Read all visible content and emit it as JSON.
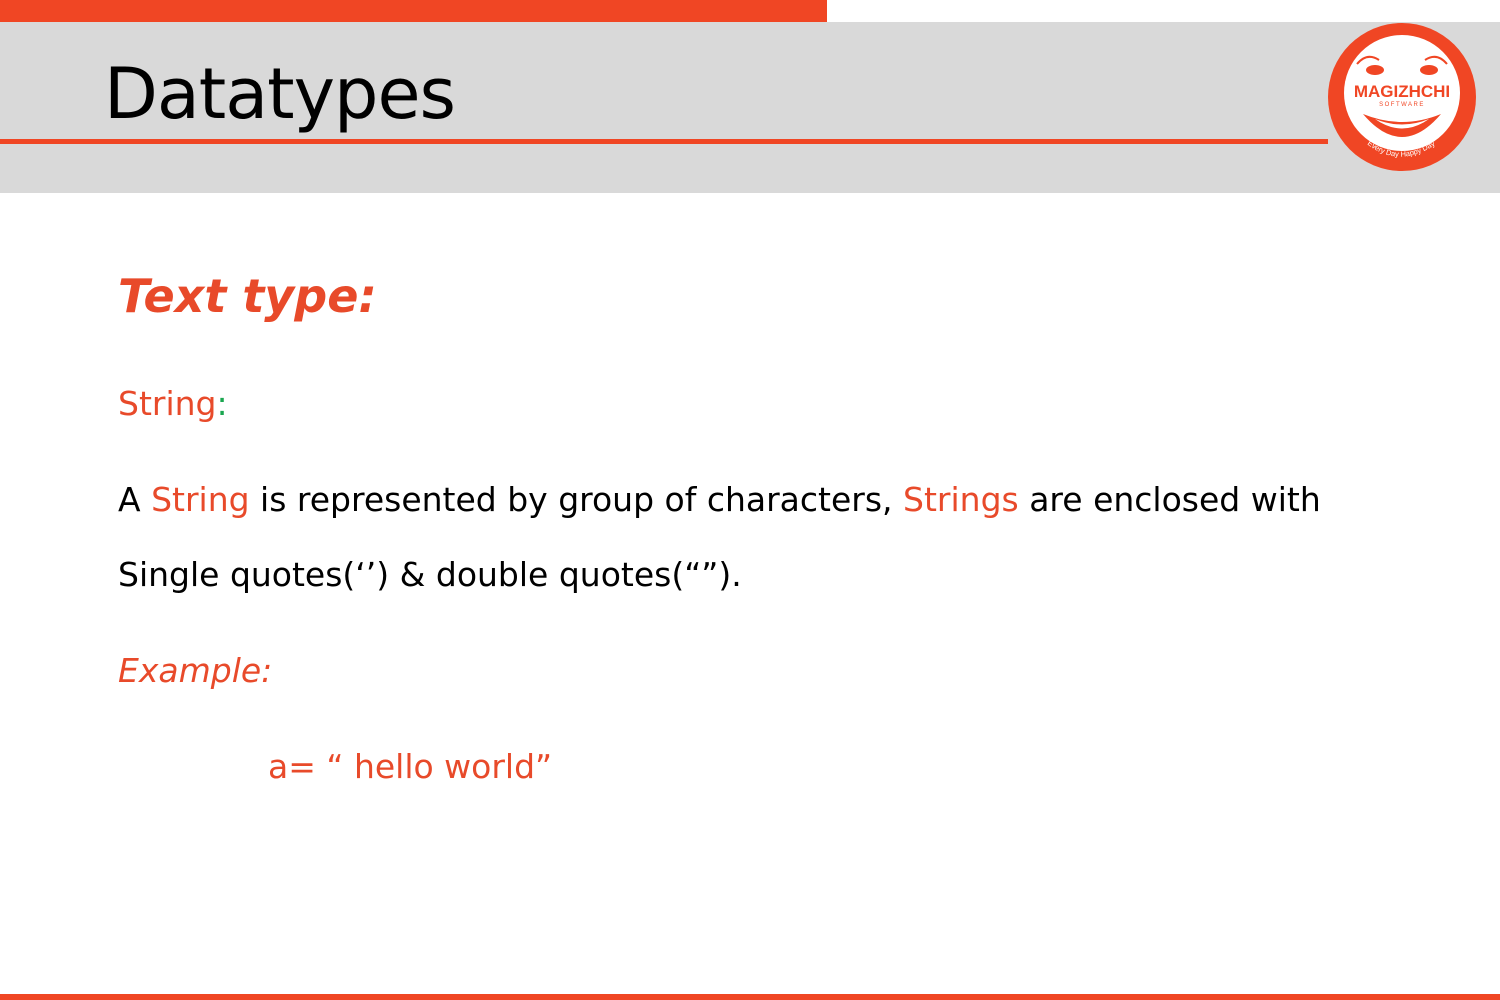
{
  "slide": {
    "title": "Datatypes",
    "heading": "Text type:",
    "sub_label": "String",
    "sub_label_colon": ":",
    "para1": {
      "t1": "A ",
      "t2": "String",
      "t3": " is represented by group of characters, ",
      "t4": "Strings",
      "t5": " are enclosed with"
    },
    "para2": "Single quotes(‘’) & double quotes(“”).",
    "example_label": "Example:",
    "example_code": "a= “ hello world”"
  },
  "logo": {
    "name": "MAGIZHCHI",
    "sub": "SOFTWARE",
    "tagline": "Every Day Happy Day"
  },
  "colors": {
    "accent": "#f04624",
    "text_red": "#e84a2a",
    "green": "#1aa650",
    "band": "#d9d9d9"
  }
}
